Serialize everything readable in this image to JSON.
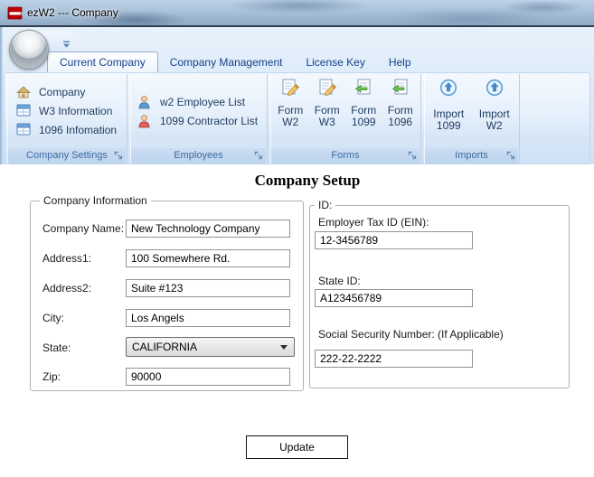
{
  "window": {
    "title": "ezW2 --- Company"
  },
  "tabs": [
    {
      "label": "Current Company",
      "active": true
    },
    {
      "label": "Company Management",
      "active": false
    },
    {
      "label": "License Key",
      "active": false
    },
    {
      "label": "Help",
      "active": false
    }
  ],
  "ribbon": {
    "groups": [
      {
        "label": "Company Settings",
        "items": [
          {
            "label": "Company",
            "icon": "house-icon"
          },
          {
            "label": "W3 Information",
            "icon": "form-grid-icon"
          },
          {
            "label": "1096 Infomation",
            "icon": "form-grid-icon"
          }
        ]
      },
      {
        "label": "Employees",
        "items": [
          {
            "label": "w2 Employee List",
            "icon": "person-blue-icon"
          },
          {
            "label": "1099 Contractor List",
            "icon": "person-red-icon"
          }
        ]
      },
      {
        "label": "Forms",
        "items": [
          {
            "line1": "Form",
            "line2": "W2",
            "icon": "form-edit-icon"
          },
          {
            "line1": "Form",
            "line2": "W3",
            "icon": "form-edit-icon"
          },
          {
            "line1": "Form",
            "line2": "1099",
            "icon": "form-return-icon"
          },
          {
            "line1": "Form",
            "line2": "1096",
            "icon": "form-return-icon"
          }
        ]
      },
      {
        "label": "Imports",
        "items": [
          {
            "line1": "Import",
            "line2": "1099",
            "icon": "import-icon"
          },
          {
            "line1": "Import",
            "line2": "W2",
            "icon": "import-icon"
          }
        ]
      }
    ]
  },
  "main": {
    "heading": "Company Setup",
    "company_information": {
      "legend": "Company Information",
      "fields": [
        {
          "label": "Company Name:",
          "value": "New Technology Company",
          "control": "textbox"
        },
        {
          "label": "Address1:",
          "value": "100 Somewhere Rd.",
          "control": "textbox"
        },
        {
          "label": "Address2:",
          "value": "Suite #123",
          "control": "textbox"
        },
        {
          "label": "City:",
          "value": "Los Angels",
          "control": "textbox"
        },
        {
          "label": "State:",
          "value": "CALIFORNIA",
          "control": "dropdown"
        },
        {
          "label": "Zip:",
          "value": "90000",
          "control": "textbox"
        }
      ]
    },
    "ids": {
      "legend": "ID:",
      "fields": [
        {
          "label": "Employer Tax ID (EIN):",
          "value": "12-3456789"
        },
        {
          "label": "State ID:",
          "value": "A123456789"
        },
        {
          "label": "Social Security Number: (If Applicable)",
          "value": "222-22-2222"
        }
      ]
    },
    "update_button_label": "Update"
  },
  "colors": {
    "app_icon_red": "#c00000",
    "tab_text_blue": "#15428b",
    "ribbon_caption_blue": "#3e6aa0",
    "ribbon_item_text": "#1d3a5f"
  }
}
